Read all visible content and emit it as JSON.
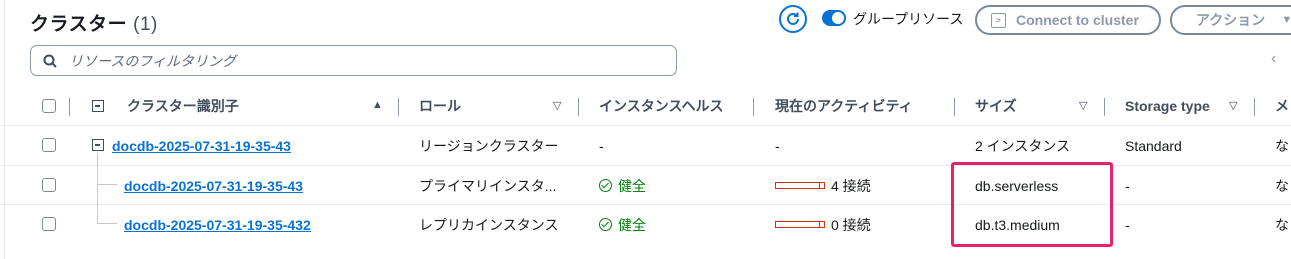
{
  "header": {
    "title": "クラスター",
    "count": "(1)",
    "toggle_label": "グループリソース",
    "connect_button": "Connect to cluster",
    "actions_button": "アクション"
  },
  "search": {
    "placeholder": "リソースのフィルタリング"
  },
  "columns": {
    "identifier": "クラスター識別子",
    "role": "ロール",
    "health": "インスタンスヘルス",
    "activity": "現在のアクティビティ",
    "size": "サイズ",
    "storage": "Storage type",
    "cut": "メ"
  },
  "rows": [
    {
      "id": "docdb-2025-07-31-19-35-43",
      "role": "リージョンクラスター",
      "health": "-",
      "activity": "-",
      "size": "2 インスタンス",
      "storage": "Standard",
      "cut": "な"
    },
    {
      "id": "docdb-2025-07-31-19-35-43",
      "role": "プライマリインスタ...",
      "health": "健全",
      "activity": "4 接続",
      "size": "db.serverless",
      "storage": "-",
      "cut": "な"
    },
    {
      "id": "docdb-2025-07-31-19-35-432",
      "role": "レプリカインスタンス",
      "health": "健全",
      "activity": "0 接続",
      "size": "db.t3.medium",
      "storage": "-",
      "cut": "な"
    }
  ],
  "colors": {
    "accent": "#0972d3",
    "success": "#037f0c",
    "highlight": "#e7226d"
  }
}
